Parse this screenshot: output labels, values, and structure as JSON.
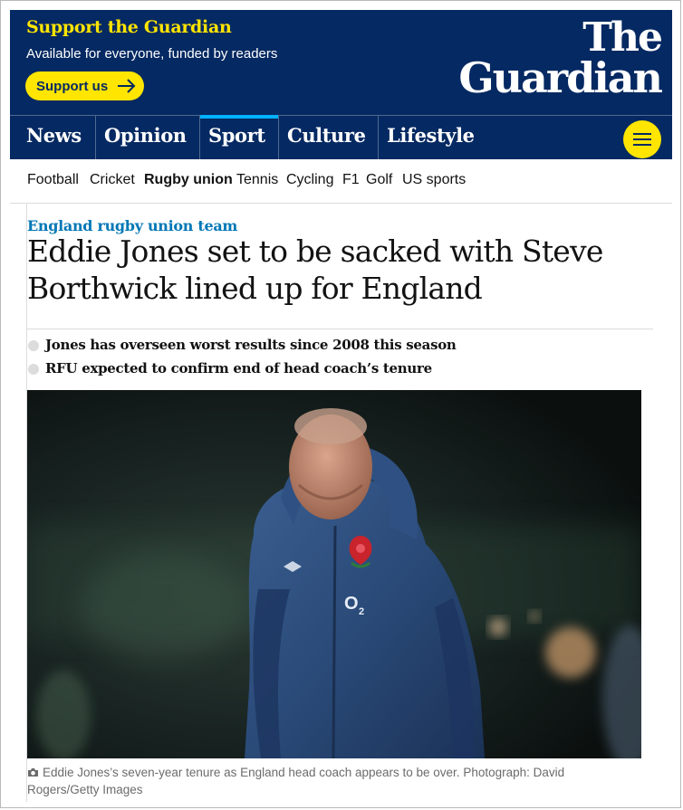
{
  "header": {
    "support_title": "Support the Guardian",
    "support_subtitle": "Available for everyone, funded by readers",
    "support_button": "Support us",
    "logo_line1": "The",
    "logo_line2": "Guardian",
    "brand_color": "#052962",
    "accent_color": "#ffe500"
  },
  "nav": {
    "items": [
      {
        "label": "News"
      },
      {
        "label": "Opinion"
      },
      {
        "label": "Sport",
        "active": true
      },
      {
        "label": "Culture"
      },
      {
        "label": "Lifestyle"
      }
    ],
    "menu_icon": "hamburger-menu-icon"
  },
  "subnav": {
    "items": [
      "Football",
      "Cricket",
      "Rugby union",
      "Tennis",
      "Cycling",
      "F1",
      "Golf",
      "US sports"
    ],
    "active": "Rugby union"
  },
  "article": {
    "kicker": "England rugby union team",
    "kicker_color": "#0077b6",
    "headline": "Eddie Jones set to be sacked with Steve Borthwick lined up for England",
    "bullets": [
      "Jones has overseen worst results since 2008 this season",
      "RFU expected to confirm end of head coach’s tenure"
    ],
    "caption": "Eddie Jones’s seven-year tenure as England head coach appears to be over. Photograph: David Rogers/Getty Images",
    "caption_icon": "camera-icon"
  }
}
